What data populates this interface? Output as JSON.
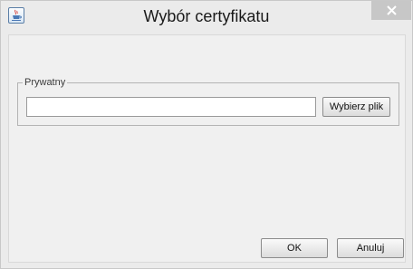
{
  "window": {
    "title": "Wybór certyfikatu"
  },
  "group": {
    "legend": "Prywatny",
    "path_value": "",
    "path_placeholder": "",
    "browse_label": "Wybierz plik"
  },
  "buttons": {
    "ok_label": "OK",
    "cancel_label": "Anuluj"
  },
  "icons": {
    "app": "java-cup-icon",
    "close": "close-icon"
  },
  "colors": {
    "close_button_bg": "#c7c7c7",
    "window_bg": "#ebebeb",
    "client_bg": "#f0f0f0"
  }
}
